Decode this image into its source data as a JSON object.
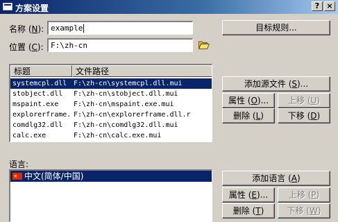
{
  "window": {
    "title": "方案设置",
    "help_label": "?",
    "close_label": "×"
  },
  "name_field": {
    "label_prefix": "名称 (",
    "label_key": "N",
    "label_suffix": "):",
    "value": "example"
  },
  "location_field": {
    "label_prefix": "位置 (",
    "label_key": "C",
    "label_suffix": "):",
    "value": "F:\\zh-cn",
    "browse_icon": "folder-open-icon"
  },
  "target_rules_button": {
    "label": "目标规则..."
  },
  "files_list": {
    "columns": [
      "标题",
      "文件路径"
    ],
    "rows": [
      {
        "title": "systemcpl.dll",
        "path": "F:\\zh-cn\\systemcpl.dll.mui",
        "selected": true
      },
      {
        "title": "stobject.dll",
        "path": "F:\\zh-cn\\stobject.dll.mui",
        "selected": false
      },
      {
        "title": "mspaint.exe",
        "path": "F:\\zh-cn\\mspaint.exe.mui",
        "selected": false
      },
      {
        "title": "explorerframe.",
        "path": "F:\\zh-cn\\explorerframe.dll.r",
        "selected": false
      },
      {
        "title": "comdlg32.dll",
        "path": "F:\\zh-cn\\comdlg32.dll.mui",
        "selected": false
      },
      {
        "title": "calc.exe",
        "path": "F:\\zh-cn\\calc.exe.mui",
        "selected": false
      }
    ]
  },
  "file_buttons": {
    "add_source": {
      "text": "添加源文件 (",
      "key": "S",
      "suffix": ")..."
    },
    "properties": {
      "text": "属性 (",
      "key": "O",
      "suffix": ")..."
    },
    "move_up": {
      "text": "上移 (",
      "key": "U",
      "suffix": ")"
    },
    "delete": {
      "text": "删除 (",
      "key": "L",
      "suffix": ")"
    },
    "move_down": {
      "text": "下移 (",
      "key": "D",
      "suffix": ")"
    }
  },
  "language_section": {
    "label": "语言:",
    "items": [
      {
        "label": "中文(简体/中国)",
        "selected": true
      }
    ]
  },
  "lang_buttons": {
    "add_language": {
      "text": "添加语言 (",
      "key": "A",
      "suffix": ")"
    },
    "properties": {
      "text": "属性 (",
      "key": "E",
      "suffix": ")..."
    },
    "move_up": {
      "text": "上移 (",
      "key": "P",
      "suffix": ")"
    },
    "delete": {
      "text": "删除 (",
      "key": "T",
      "suffix": ")"
    },
    "move_down": {
      "text": "下移 (",
      "key": "W",
      "suffix": ")"
    }
  },
  "colors": {
    "face": "#d4d0c8",
    "title_start": "#0a246a",
    "title_end": "#a6caf0",
    "selection": "#0a246a"
  }
}
